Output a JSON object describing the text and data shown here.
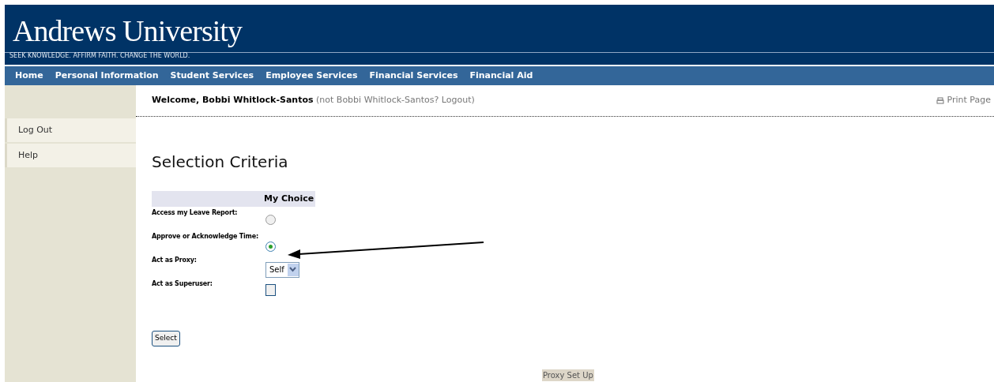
{
  "header": {
    "title": "Andrews University",
    "tagline": "SEEK KNOWLEDGE.  AFFIRM FAITH.  CHANGE THE WORLD."
  },
  "nav": [
    "Home",
    "Personal Information",
    "Student Services",
    "Employee Services",
    "Financial Services",
    "Financial Aid"
  ],
  "sidebar": {
    "items": [
      "Log Out",
      "Help"
    ]
  },
  "welcome": {
    "greeting": "Welcome, Bobbi Whitlock-Santos",
    "note": "(not Bobbi Whitlock-Santos? Logout)"
  },
  "print_link": "Print Page",
  "heading": "Selection Criteria",
  "form": {
    "column_header": "My Choice",
    "rows": [
      {
        "label": "Access my Leave Report:",
        "kind": "radio",
        "selected": false
      },
      {
        "label": "Approve or Acknowledge Time:",
        "kind": "radio",
        "selected": true
      },
      {
        "label": "Act as Proxy:",
        "kind": "select",
        "value": "Self"
      },
      {
        "label": "Act as Superuser:",
        "kind": "checkbox",
        "checked": false
      }
    ],
    "submit": "Select"
  },
  "footer_link": "Proxy Set Up"
}
